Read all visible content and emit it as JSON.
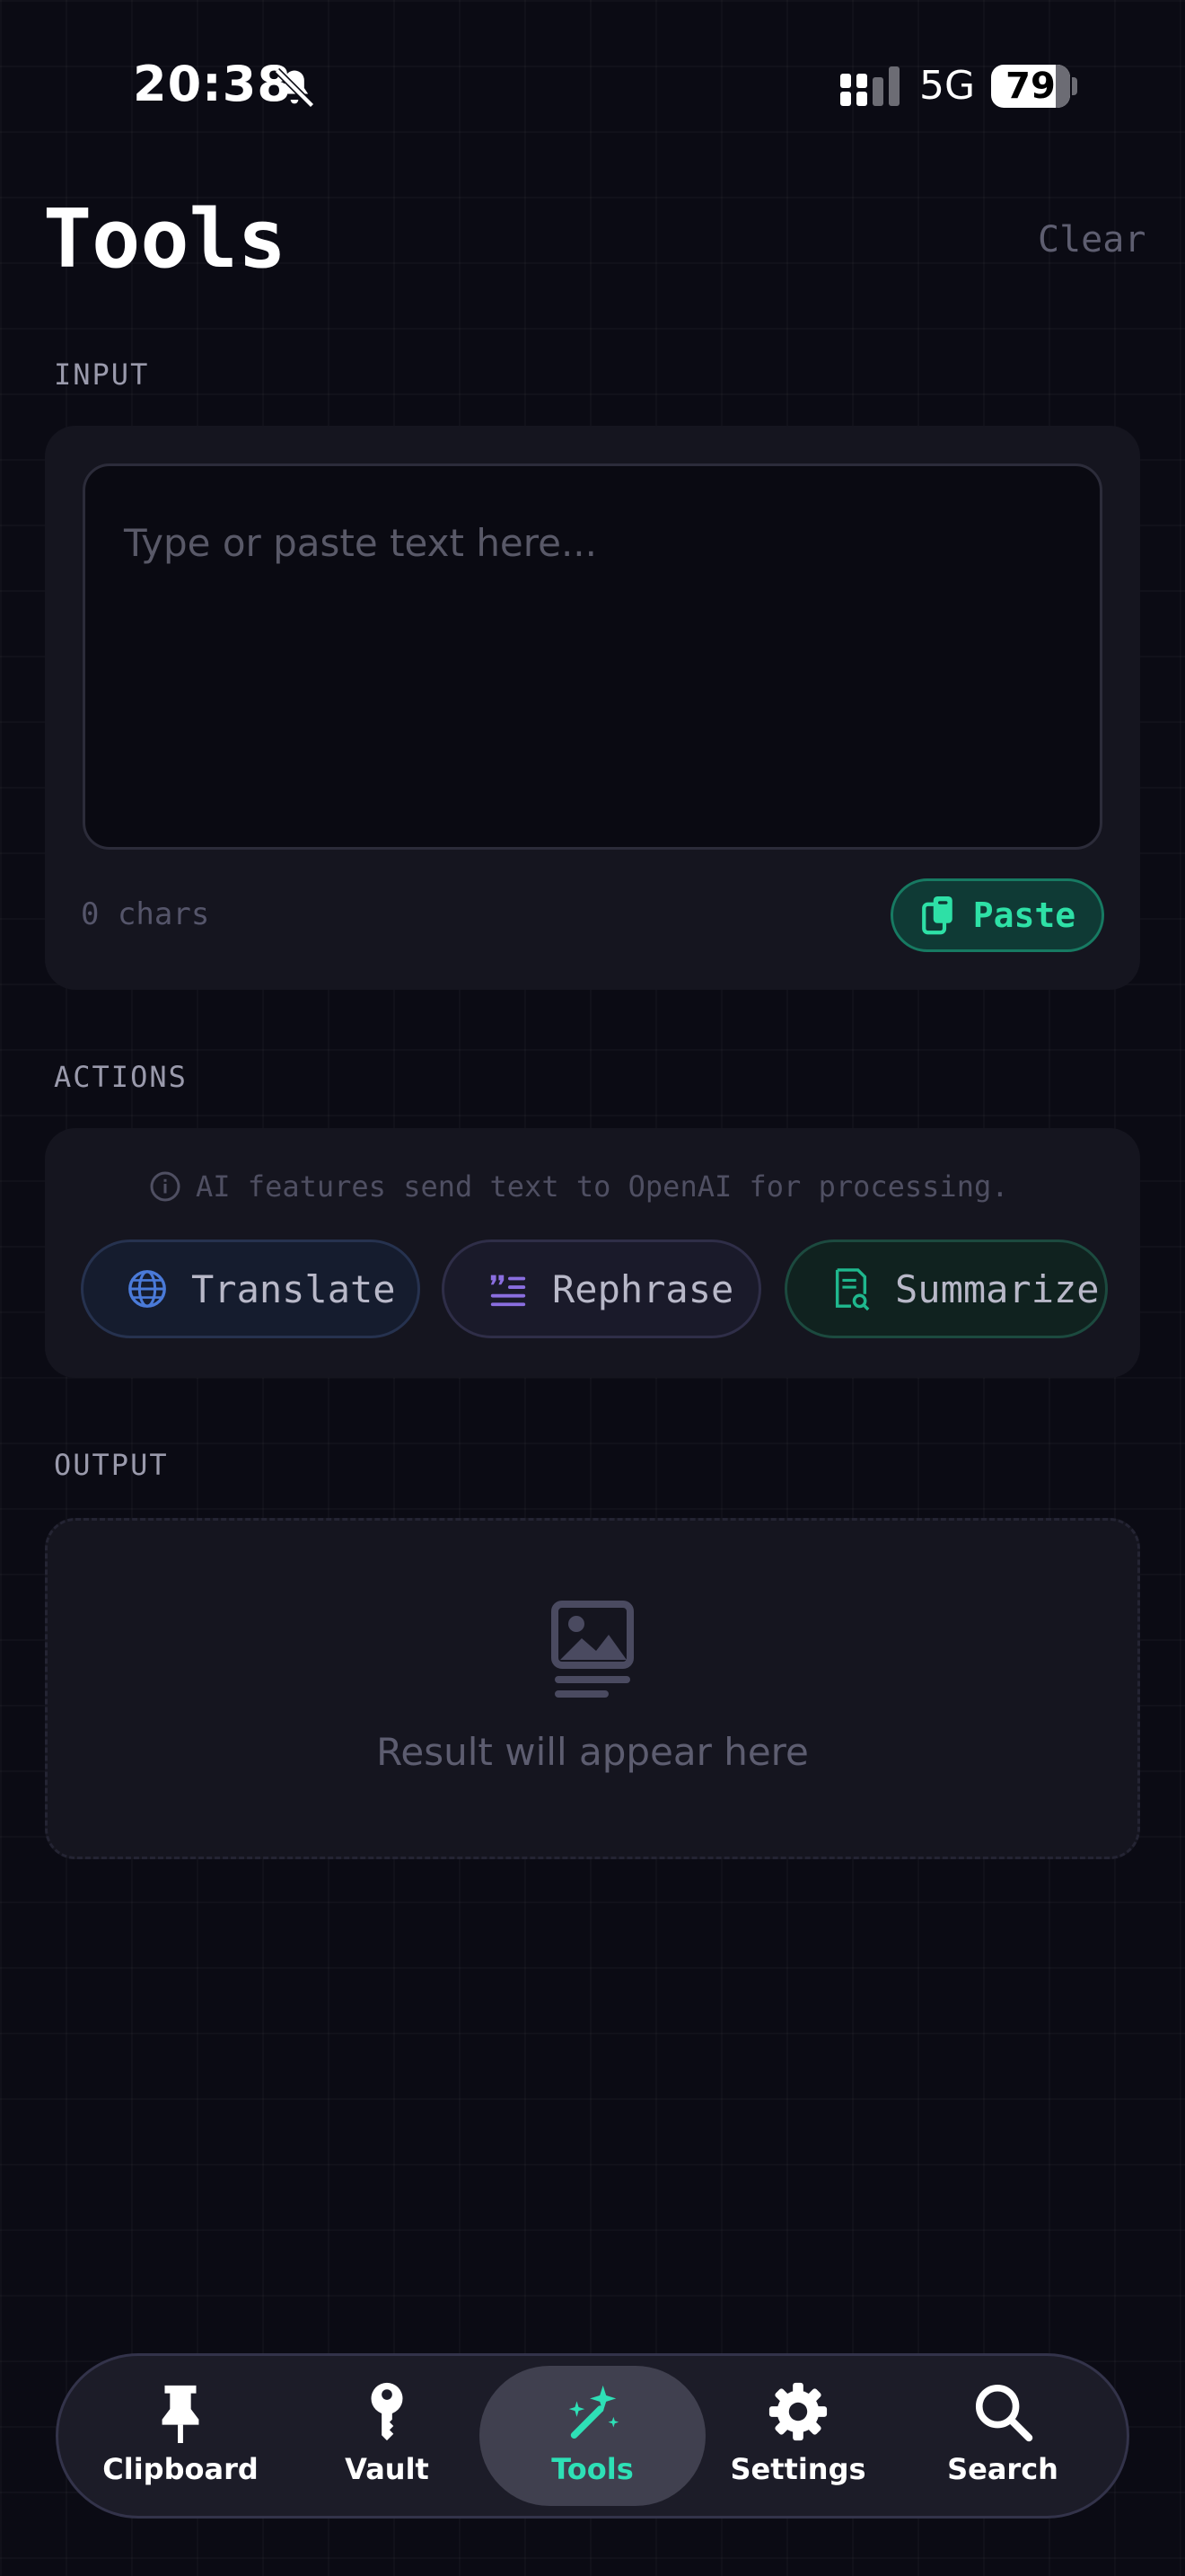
{
  "status_bar": {
    "time": "20:38",
    "network": "5G",
    "battery": "79"
  },
  "header": {
    "title": "Tools",
    "clear_label": "Clear"
  },
  "input": {
    "section_label": "INPUT",
    "placeholder": "Type or paste text here...",
    "char_count": "0 chars",
    "paste_label": "Paste"
  },
  "actions": {
    "section_label": "ACTIONS",
    "notice": "AI features send text to OpenAI for processing.",
    "buttons": [
      {
        "label": "Translate",
        "icon": "globe-icon"
      },
      {
        "label": "Rephrase",
        "icon": "quote-lines-icon"
      },
      {
        "label": "Summarize",
        "icon": "document-search-icon"
      }
    ]
  },
  "output": {
    "section_label": "OUTPUT",
    "empty_text": "Result will appear here"
  },
  "nav": {
    "items": [
      {
        "label": "Clipboard",
        "icon": "pin-icon"
      },
      {
        "label": "Vault",
        "icon": "key-icon"
      },
      {
        "label": "Tools",
        "icon": "magic-wand-icon"
      },
      {
        "label": "Settings",
        "icon": "gear-icon"
      },
      {
        "label": "Search",
        "icon": "search-icon"
      }
    ],
    "active": "Tools"
  },
  "colors": {
    "accent": "#2ee0b6",
    "background": "#0b0b14",
    "card": "#15151f"
  }
}
